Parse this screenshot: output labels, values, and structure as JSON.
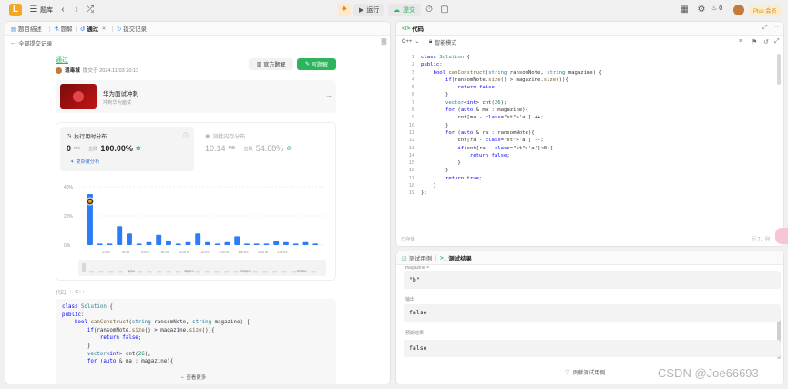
{
  "topbar": {
    "title": "题库",
    "run_label": "运行",
    "submit_label": "提交",
    "fire_count": "0",
    "plus_label": "Plus 会员"
  },
  "left": {
    "tabs": [
      "题目描述",
      "题解",
      "通过",
      "提交记录"
    ],
    "back_label": "全部提交记录",
    "status": "通过",
    "author": "遗毒城",
    "submitted_at": "提交于 2024.11.03 20:13",
    "official_solution": "官方题解",
    "write_solution": "写题解",
    "promo": {
      "title": "华为面试冲刺",
      "subtitle": "冲刺华为面试"
    },
    "runtime": {
      "title": "执行用时分布",
      "value": "0",
      "unit": "ms",
      "beat_label": "击败",
      "beat": "100.00%",
      "complexity_link": "复杂度分析"
    },
    "memory": {
      "title": "消耗内存分布",
      "value": "10.14",
      "unit": "MB",
      "beat_label": "击败",
      "beat": "54.68%"
    },
    "chart_axis": {
      "y_ticks": [
        "40%",
        "20%",
        "0%"
      ],
      "x_ticks": [
        "2ms",
        "4ms",
        "6ms",
        "8ms",
        "10ms",
        "12ms",
        "14ms",
        "16ms",
        "18ms",
        "20ms"
      ],
      "mini_ticks": [
        "5ms",
        "10ms",
        "15ms",
        "20ms"
      ]
    },
    "code_label": "代码",
    "code_lang": "C++",
    "show_more": "查看更多",
    "code_lines": [
      "class Solution {",
      "public:",
      "    bool canConstruct(string ransomNote, string magazine) {",
      "        if(ransomNote.size() > magazine.size()){",
      "            return false;",
      "        }",
      "        vector<int> cnt(26);",
      "        for (auto & ma : magazine){"
    ]
  },
  "right": {
    "code_tab": "代码",
    "lang": "C++",
    "mode": "智能模式",
    "saved": "已存储",
    "cursor": "行 7，列",
    "line_numbers": [
      "1",
      "2",
      "3",
      "4",
      "5",
      "6",
      "7",
      "8",
      "9",
      "10",
      "11",
      "12",
      "13",
      "14",
      "15",
      "16",
      "17",
      "18",
      "19"
    ],
    "code_lines": [
      "class Solution {",
      "public:",
      "    bool canConstruct(string ransomNote, string magazine) {",
      "        if(ransomNote.size() > magazine.size()){",
      "            return false;",
      "        }",
      "        vector<int> cnt(26);",
      "        for (auto & ma : magazine){",
      "            cnt[ma - 'a'] ++;",
      "        }",
      "        for (auto & ra : ransomNote){",
      "            cnt[ra - 'a'] --;",
      "            if(cnt[ra - 'a']<0){",
      "                return false;",
      "            }",
      "        }",
      "        return true;",
      "    }",
      "};"
    ],
    "test_tab": "测试用例",
    "result_tab": "测试结果",
    "input_label": "magazine =",
    "input_value": "\"b\"",
    "output_label": "输出",
    "output_value": "false",
    "expected_label": "预期结果",
    "expected_value": "false",
    "contribute": "贡献测试用例"
  },
  "watermark": "CSDN @Joe66693",
  "chart_data": {
    "type": "bar",
    "ylabel": "",
    "xlabel": "",
    "ylim": [
      0,
      40
    ],
    "categories": [
      "0ms",
      "1ms",
      "2ms",
      "3ms",
      "4ms",
      "5ms",
      "6ms",
      "7ms",
      "8ms",
      "9ms",
      "10ms",
      "11ms",
      "12ms",
      "13ms",
      "14ms",
      "15ms",
      "16ms",
      "17ms",
      "18ms",
      "19ms",
      "20ms",
      "21ms",
      "22ms",
      "23ms"
    ],
    "values": [
      35,
      1,
      1,
      13,
      8,
      1,
      2,
      7,
      3,
      1,
      2,
      8,
      2,
      1,
      2,
      6,
      1,
      1,
      1,
      3,
      2,
      1,
      2,
      1
    ],
    "highlight_index": 0,
    "colors": {
      "bar": "#2b7cf6",
      "highlight": "#2b7cf6"
    }
  }
}
